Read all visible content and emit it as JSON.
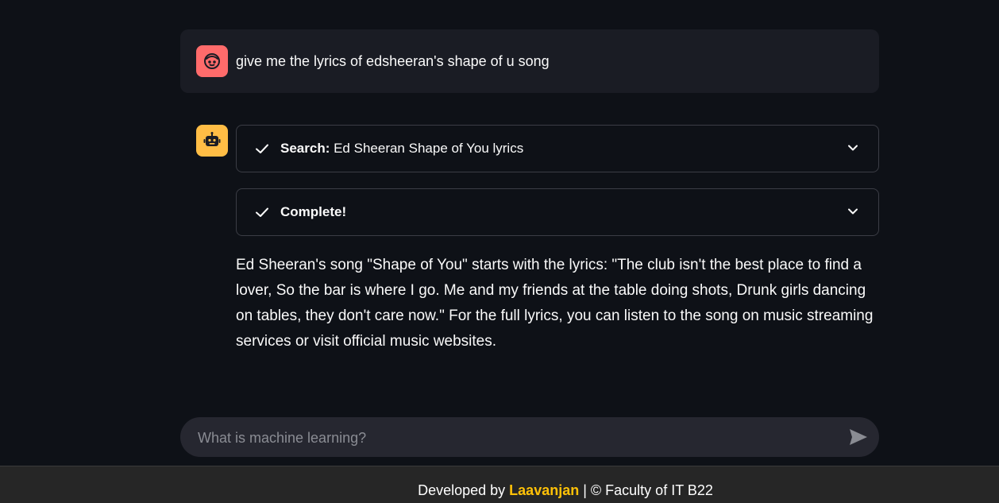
{
  "user_message": {
    "text": "give me the lyrics of edsheeran's shape of u song",
    "avatar_icon": "user-face-icon",
    "avatar_color": "#ff6b6b"
  },
  "assistant": {
    "avatar_icon": "robot-icon",
    "avatar_color": "#ffbd45",
    "steps": [
      {
        "status_icon": "check-icon",
        "label_bold": "Search:",
        "label_rest": " Ed Sheeran Shape of You lyrics",
        "expand_icon": "chevron-down-icon"
      },
      {
        "status_icon": "check-icon",
        "label_bold": "Complete!",
        "label_rest": "",
        "expand_icon": "chevron-down-icon"
      }
    ],
    "answer": "Ed Sheeran's song \"Shape of You\" starts with the lyrics: \"The club isn't the best place to find a lover, So the bar is where I go. Me and my friends at the table doing shots, Drunk girls dancing on tables, they don't care now.\" For the full lyrics, you can listen to the song on music streaming services or visit official music websites."
  },
  "chat_input": {
    "placeholder": "What is machine learning?",
    "value": "",
    "send_icon": "send-icon"
  },
  "footer": {
    "prefix": "Developed by ",
    "author": "Laavanjan",
    "suffix": " | © Faculty of IT B22",
    "author_color": "#ffc107"
  }
}
